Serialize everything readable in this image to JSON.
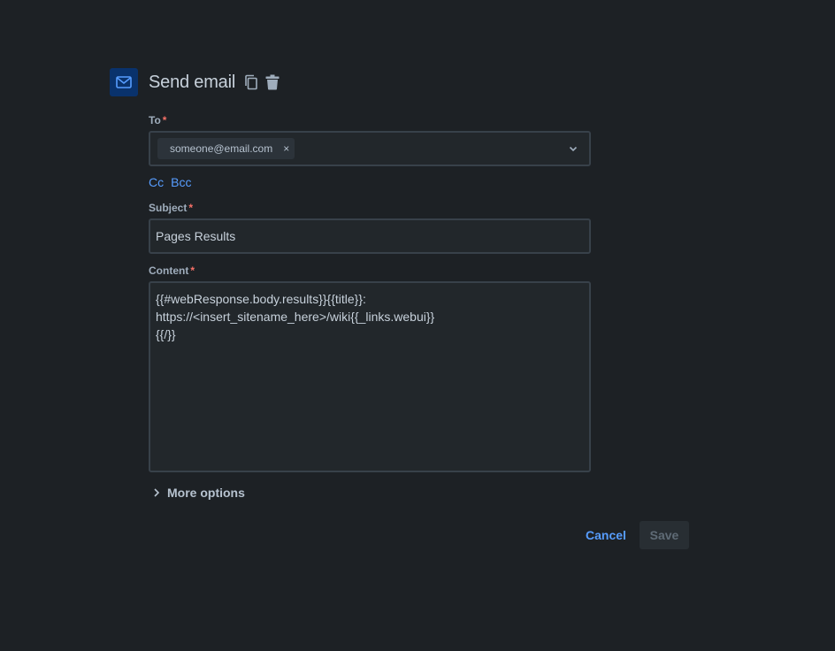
{
  "header": {
    "title": "Send email",
    "icons": [
      "mail-icon",
      "copy-icon",
      "trash-icon"
    ],
    "accent_bg": "#09326c",
    "accent": "#579dff"
  },
  "to": {
    "label": "To",
    "required_mark": "*",
    "recipients": [
      "someone@email.com"
    ],
    "remove_glyph": "×"
  },
  "cc_label": "Cc",
  "bcc_label": "Bcc",
  "subject": {
    "label": "Subject",
    "required_mark": "*",
    "value": "Pages Results"
  },
  "content": {
    "label": "Content",
    "required_mark": "*",
    "value": "{{#webResponse.body.results}}{{title}}:\nhttps://<insert_sitename_here>/wiki{{_links.webui}}\n{{/}}"
  },
  "more_options_label": "More options",
  "actions": {
    "cancel_label": "Cancel",
    "save_label": "Save"
  }
}
